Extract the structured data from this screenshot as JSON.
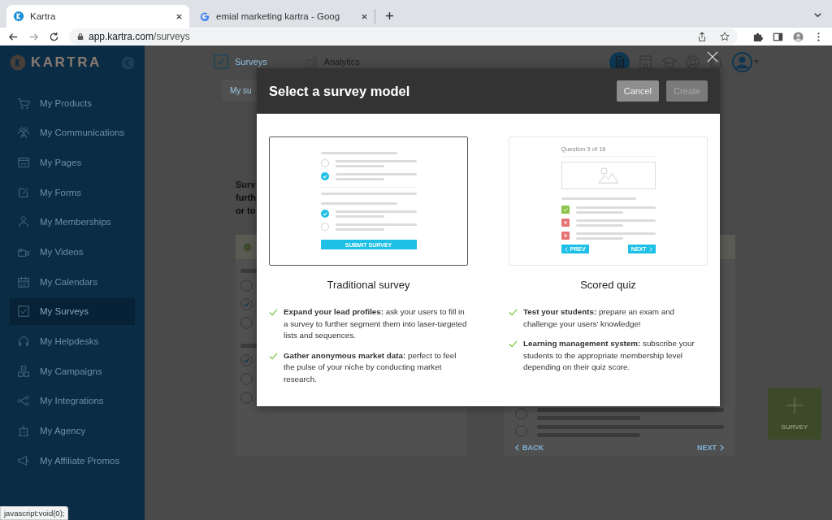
{
  "browser": {
    "tabs": [
      {
        "title": "Kartra",
        "selected": true
      },
      {
        "title": "emial marketing kartra - Goog",
        "selected": false
      }
    ],
    "url": {
      "host": "app.kartra.com",
      "path": "/surveys"
    },
    "status_text": "javascript:void(0);"
  },
  "sidebar": {
    "logo": "KARTRA",
    "items": [
      {
        "label": "My Products",
        "selected": false
      },
      {
        "label": "My Communications",
        "selected": false
      },
      {
        "label": "My Pages",
        "selected": false
      },
      {
        "label": "My Forms",
        "selected": false
      },
      {
        "label": "My Memberships",
        "selected": false
      },
      {
        "label": "My Videos",
        "selected": false
      },
      {
        "label": "My Calendars",
        "selected": false
      },
      {
        "label": "My Surveys",
        "selected": true
      },
      {
        "label": "My Helpdesks",
        "selected": false
      },
      {
        "label": "My Campaigns",
        "selected": false
      },
      {
        "label": "My Integrations",
        "selected": false
      },
      {
        "label": "My Agency",
        "selected": false
      },
      {
        "label": "My Affiliate Promos",
        "selected": false
      }
    ]
  },
  "page": {
    "nav_tabs": [
      {
        "label": "Surveys",
        "selected": true
      },
      {
        "label": "Analytics",
        "selected": false
      }
    ],
    "subtab": "My su",
    "intro_lines": [
      "Surv",
      "furth",
      "or to"
    ],
    "survey_card": {
      "options": [
        {
          "checked": false
        },
        {
          "checked": true
        },
        {
          "checked": false
        },
        {
          "checked": true
        },
        {
          "checked": false
        },
        {
          "checked": false
        }
      ]
    },
    "quiz_card": {
      "options": [
        {
          "checked": false
        },
        {
          "checked": false
        }
      ],
      "back": "BACK",
      "next": "NEXT"
    },
    "add_button": "SURVEY"
  },
  "modal": {
    "title": "Select a survey model",
    "buttons": [
      {
        "label": "Cancel",
        "disabled": false
      },
      {
        "label": "Create",
        "disabled": true
      }
    ],
    "options": [
      {
        "kind": "survey",
        "title": "Traditional survey",
        "selected": true,
        "preview": {
          "answers": [
            {
              "checked": false
            },
            {
              "checked": true
            },
            {
              "checked": true
            },
            {
              "checked": false
            }
          ],
          "submit": "SUBMIT SURVEY"
        },
        "features": [
          "**Expand your lead profiles:** ask your users to fill in a survey to further segment them into laser-targeted lists and sequences.",
          "**Gather anonymous market data:** perfect to feel the pulse of your niche by conducting market research."
        ]
      },
      {
        "kind": "quiz",
        "title": "Scored quiz",
        "selected": false,
        "preview": {
          "question": "Question 9 of 16",
          "answers": [
            {
              "correct": true
            },
            {
              "correct": false
            },
            {
              "correct": false
            }
          ],
          "prev": "PREV",
          "next": "NEXT"
        },
        "features": [
          "**Test your students:** prepare an exam and challenge your users' knowledge!",
          "**Learning management system:** subscribe your students to the appropriate membership level depending on their quiz score."
        ]
      }
    ]
  }
}
